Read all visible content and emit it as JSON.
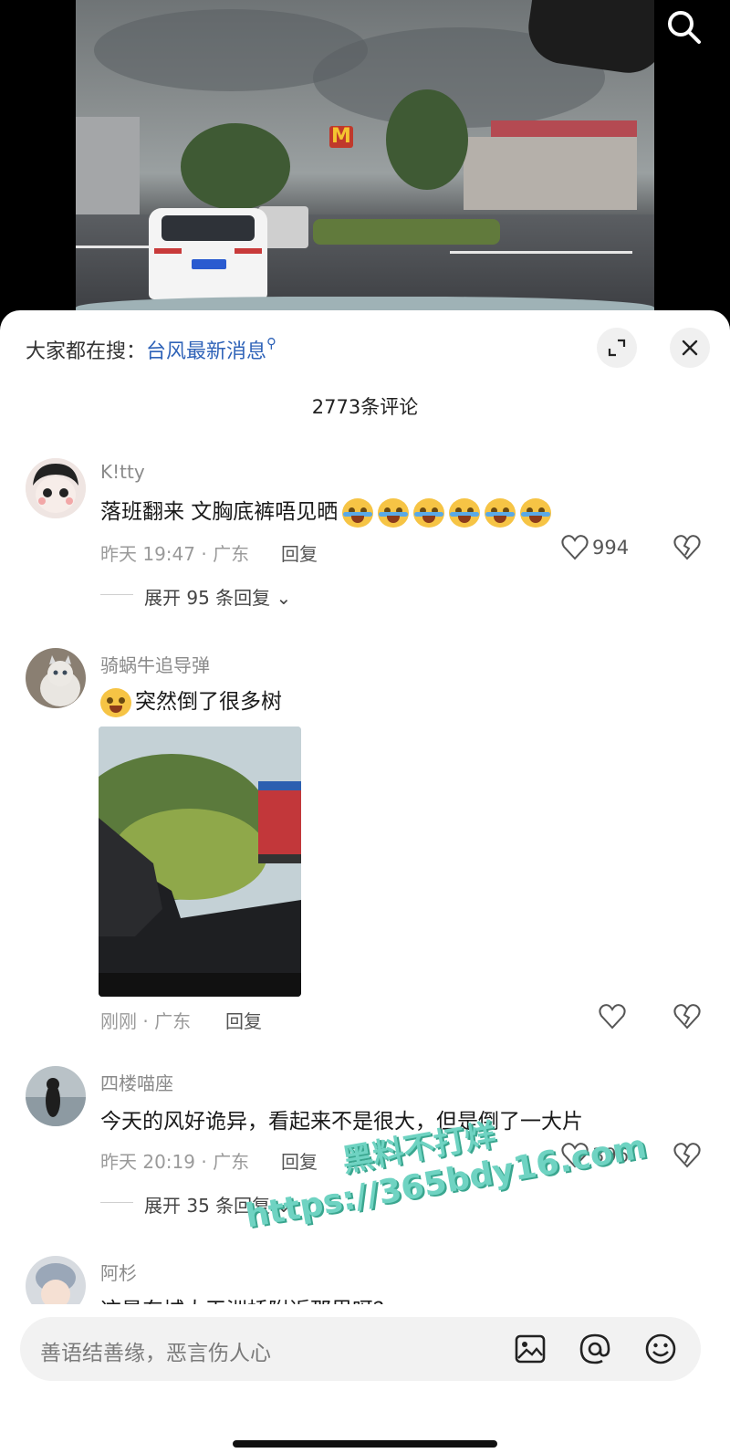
{
  "header": {
    "hot_search_prefix": "大家都在搜：",
    "hot_search_keyword": "台风最新消息",
    "comment_count": "2773条评论"
  },
  "comments": [
    {
      "user": "K!tty",
      "text": "落班翻来 文胸底裤唔见晒",
      "emoji": "crying-laughing-emoji",
      "emoji_count": 6,
      "time_location": "昨天 19:47 · 广东",
      "reply_label": "回复",
      "likes": "994",
      "expand_replies": "展开 95 条回复"
    },
    {
      "user": "骑蜗牛追导弹",
      "text": "突然倒了很多树",
      "emoji": "shy-face-emoji",
      "has_photo": true,
      "time_location": "刚刚 · 广东",
      "reply_label": "回复",
      "likes": ""
    },
    {
      "user": "四楼喵座",
      "text": "今天的风好诡异，看起来不是很大，但是倒了一大片",
      "time_location": "昨天 20:19 · 广东",
      "reply_label": "回复",
      "likes": "396",
      "expand_replies": "展开 35 条回复"
    },
    {
      "user": "阿杉",
      "text": "这是东城大王洲桥附近那里呀？"
    }
  ],
  "input": {
    "placeholder": "善语结善缘，恶言伤人心"
  },
  "watermark": {
    "line1": "黑料不打烊",
    "line2": "https://365bdy16.com"
  },
  "icons": {
    "search": "search-icon",
    "expand": "expand-icon",
    "close": "close-icon",
    "like": "heart-icon",
    "dislike": "broken-heart-icon",
    "image": "image-icon",
    "mention": "at-icon",
    "emoji": "smiley-icon"
  },
  "colors": {
    "keyword_blue": "#2f63b8",
    "watermark_teal": "#6fd3c2"
  }
}
